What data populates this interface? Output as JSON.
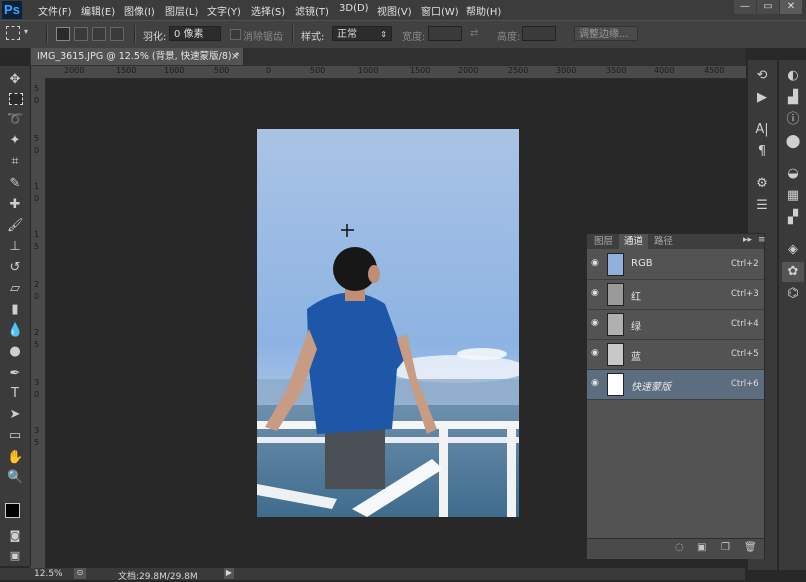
{
  "app": {
    "logo": "Ps"
  },
  "menu": [
    "文件(F)",
    "编辑(E)",
    "图像(I)",
    "图层(L)",
    "文字(Y)",
    "选择(S)",
    "滤镜(T)",
    "3D(D)",
    "视图(V)",
    "窗口(W)",
    "帮助(H)"
  ],
  "window_buttons": {
    "minimize": "—",
    "restore": "▭",
    "close": "✕"
  },
  "options": {
    "feather_label": "羽化:",
    "feather_value": "0 像素",
    "antialias_label": "消除锯齿",
    "style_label": "样式:",
    "style_value": "正常",
    "width_label": "宽度:",
    "height_label": "高度:",
    "refine_button": "调整边缘..."
  },
  "document_tab": {
    "title": "IMG_3615.JPG @ 12.5% (背景, 快速蒙版/8) *",
    "close": "×"
  },
  "ruler": {
    "h_ticks": [
      "2000",
      "1500",
      "1000",
      "500",
      "0",
      "500",
      "1000",
      "1500",
      "2000",
      "2500",
      "3000",
      "3500",
      "4000",
      "4500"
    ],
    "v_ticks": [
      "5",
      "0",
      "5",
      "0",
      "1",
      "0",
      "1",
      "5",
      "2",
      "0",
      "2",
      "5",
      "3",
      "0",
      "3",
      "5"
    ]
  },
  "channels_panel": {
    "tabs": [
      "图层",
      "通道",
      "路径"
    ],
    "active_tab": "通道",
    "rows": [
      {
        "name": "RGB",
        "shortcut": "Ctrl+2"
      },
      {
        "name": "红",
        "shortcut": "Ctrl+3"
      },
      {
        "name": "绿",
        "shortcut": "Ctrl+4"
      },
      {
        "name": "蓝",
        "shortcut": "Ctrl+5"
      },
      {
        "name": "快速蒙版",
        "shortcut": "Ctrl+6"
      }
    ]
  },
  "status": {
    "zoom": "12.5%",
    "doc": "文档:29.8M/29.8M"
  },
  "colors": {
    "accent": "#5d6d80",
    "menubar": "#3c3c3c",
    "canvas": "#282828"
  }
}
